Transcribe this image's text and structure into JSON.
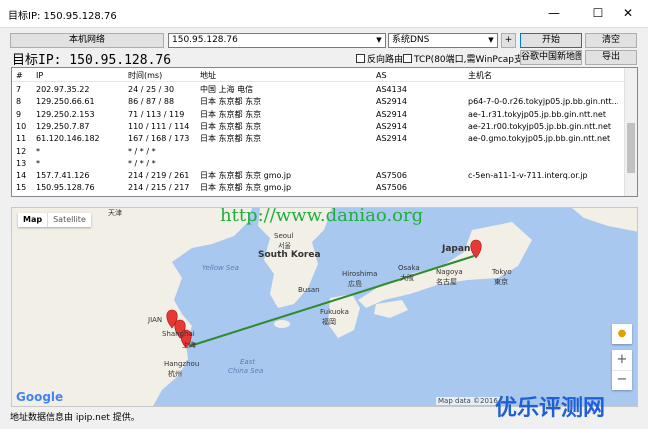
{
  "window": {
    "title": "目标IP: 150.95.128.76",
    "minimize": "—",
    "maximize": "☐",
    "close": "✕"
  },
  "toolbar": {
    "local_network_label": "本机网络",
    "ip_value": "150.95.128.76",
    "dns_value": "系统DNS",
    "plus_label": "+",
    "start_label": "开始",
    "clear_label": "清空",
    "export_label": "导出",
    "google_map_label": "谷歌中国新地图"
  },
  "target_label": "目标IP: 150.95.128.76",
  "options": {
    "reverse_route": "反向路由",
    "tcp_option": "TCP(80端口,需WinPcap支持)"
  },
  "table": {
    "headers": [
      "#",
      "IP",
      "时间(ms)",
      "地址",
      "AS",
      "主机名"
    ],
    "rows": [
      [
        "7",
        "202.97.35.22",
        "24 / 25 / 30",
        "中国 上海 电信",
        "AS4134",
        ""
      ],
      [
        "8",
        "129.250.66.61",
        "86 / 87 / 88",
        "日本 东京都 东京",
        "AS2914",
        "p64-7-0-0.r26.tokyjp05.jp.bb.gin.ntt..."
      ],
      [
        "9",
        "129.250.2.153",
        "71 / 113 / 119",
        "日本 东京都 东京",
        "AS2914",
        "ae-1.r31.tokyjp05.jp.bb.gin.ntt.net"
      ],
      [
        "10",
        "129.250.7.87",
        "110 / 111 / 114",
        "日本 东京都 东京",
        "AS2914",
        "ae-21.r00.tokyjp05.jp.bb.gin.ntt.net"
      ],
      [
        "11",
        "61.120.146.182",
        "167 / 168 / 173",
        "日本 东京都 东京",
        "AS2914",
        "ae-0.gmo.tokyjp05.jp.bb.gin.ntt.net"
      ],
      [
        "12",
        "*",
        "* / * / *",
        "",
        "",
        ""
      ],
      [
        "13",
        "*",
        "* / * / *",
        "",
        "",
        ""
      ],
      [
        "14",
        "157.7.41.126",
        "214 / 219 / 261",
        "日本 东京都 东京 gmo.jp",
        "AS7506",
        "c-5en-a11-1-v-711.interq.or.jp"
      ],
      [
        "15",
        "150.95.128.76",
        "214 / 215 / 217",
        "日本 东京都 东京 gmo.jp",
        "AS7506",
        ""
      ]
    ]
  },
  "map": {
    "tab_map": "Map",
    "tab_satellite": "Satellite",
    "zoom_in": "+",
    "zoom_out": "−",
    "google_logo": "Google",
    "attribution": "Map data ©2016",
    "watermark_url": "http://www.daniao.org",
    "labels": {
      "tianjin": "天津",
      "yellow_sea": "Yellow Sea",
      "seoul_en": "Seoul",
      "seoul_zh": "서울",
      "south_korea": "South Korea",
      "japan": "Japan",
      "tokyo_en": "Tokyo",
      "tokyo_zh": "東京",
      "osaka_en": "Osaka",
      "osaka_zh": "大阪",
      "nagoya_en": "Nagoya",
      "nagoya_zh": "名古屋",
      "hiroshima_en": "Hiroshima",
      "hiroshima_zh": "広島",
      "fukuoka_en": "Fukuoka",
      "fukuoka_zh": "福岡",
      "busan": "Busan",
      "shanghai_en": "Shanghai",
      "shanghai_zh": "上海",
      "hangzhou_en": "Hangzhou",
      "hangzhou_zh": "杭州",
      "east_china_sea_1": "East",
      "east_china_sea_2": "China Sea",
      "jiangsu": "JIAN"
    },
    "colors": {
      "route": "#2e8b2e",
      "marker": "#e53935",
      "water": "#a8c8ef",
      "land": "#f2efe6"
    }
  },
  "status_text": "地址数据信息由 ipip.net 提供。",
  "brand_watermark": "优乐评测网"
}
